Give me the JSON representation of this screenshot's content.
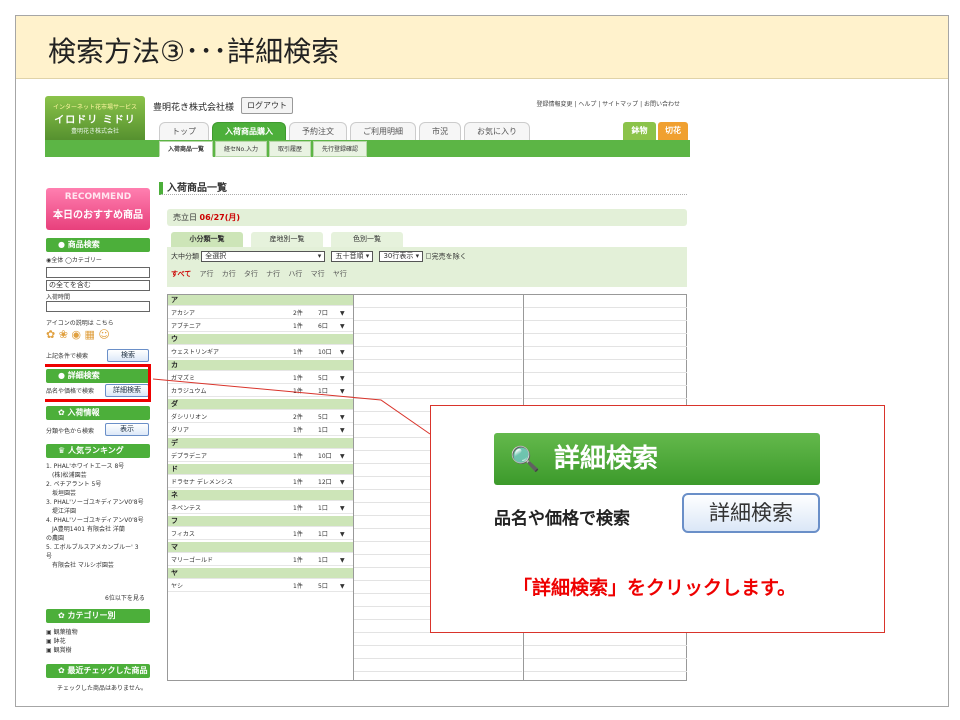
{
  "slide": {
    "title": "検索方法③･･･詳細検索"
  },
  "header": {
    "logo": {
      "line1": "インターネット花市場サービス",
      "line2": "イロドリ ミドリ",
      "line3": "豊明花き株式会社"
    },
    "company": "豊明花き株式会社様",
    "logout": "ログアウト",
    "toplinks": "登録情報変更 | ヘルプ | サイトマップ | お問い合わせ"
  },
  "tabs": [
    "トップ",
    "入荷商品購入",
    "予約注文",
    "ご利用明細",
    "市況",
    "お気に入り"
  ],
  "active_tab": "入荷商品購入",
  "right_tabs": {
    "a": "鉢物",
    "b": "切花"
  },
  "subtabs": [
    "入荷商品一覧",
    "経セNo.入力",
    "取引履歴",
    "先行登録確認"
  ],
  "sidebar": {
    "recommend_top": "RECOMMEND",
    "recommend_bottom": "本日のおすすめ商品",
    "search_head": "商品検索",
    "radio": "◉全体 ◯カテゴリー",
    "select1": "の全てを含む",
    "arrival_label": "入荷時間",
    "icon_note": "アイコンの説明は こちら",
    "condition_label": "上記条件で検索",
    "search_btn": "検索",
    "detail_head": "詳細検索",
    "detail_label": "品名や価格で検索",
    "detail_btn": "詳細検索",
    "arrival_head": "入荷情報",
    "arrival_text": "分類や色から検索",
    "show_btn": "表示",
    "ranking_head": "人気ランキング",
    "ranking": [
      "1. PHAL'ホワイトエース 8号",
      "　(株)松浦園芸",
      "2. ペチアラント 5号",
      "　坂垣園芸",
      "3. PHAL'ソーゴユキディアンV0'8号",
      "　堤江洋園",
      "4. PHAL'ソーゴユキディアンV0'8号",
      "　JA豊明1401 有限会社 洋蘭",
      "の農園",
      "5. エボルブルスアメカンブルー' 3",
      "号",
      "　有限会社 マルシポ園芸"
    ],
    "more": "6位以下を見る",
    "category_head": "カテゴリー別",
    "categories": [
      "観葉植物",
      "鉢花",
      "観賞樹"
    ],
    "recent_head": "最近チェックした商品",
    "recent_text": "チェックした商品はありません。"
  },
  "main": {
    "heading": "入荷商品一覧",
    "date_label": "売立日",
    "date_value": "06/27(月)",
    "content_tabs": [
      "小分類一覧",
      "産地別一覧",
      "色別一覧"
    ],
    "filter_label": "大中分類",
    "filter_select": "全選択",
    "sort_select": "五十音順",
    "rows_select": "30行表示",
    "exclude_label": "完売を除く",
    "kana_all": "すべて",
    "kana": "ア行 カ行 タ行 ナ行 ハ行 マ行 ヤ行"
  },
  "list": [
    {
      "head": "ア"
    },
    {
      "name": "アカシア",
      "count": "2件",
      "qty": "7口"
    },
    {
      "name": "アブチニア",
      "count": "1件",
      "qty": "6口"
    },
    {
      "head": "ウ"
    },
    {
      "name": "ウェストリンギア",
      "count": "1件",
      "qty": "10口"
    },
    {
      "head": "カ"
    },
    {
      "name": "ガマズミ",
      "count": "1件",
      "qty": "5口"
    },
    {
      "name": "カラジュウム",
      "count": "1件",
      "qty": "1口"
    },
    {
      "head": "ダ"
    },
    {
      "name": "ダシリリオン",
      "count": "2件",
      "qty": "5口"
    },
    {
      "name": "ダリア",
      "count": "1件",
      "qty": "1口"
    },
    {
      "head": "デ"
    },
    {
      "name": "デプラデニア",
      "count": "1件",
      "qty": "10口"
    },
    {
      "head": "ド"
    },
    {
      "name": "ドラセナ デレメンシス",
      "count": "1件",
      "qty": "12口"
    },
    {
      "head": "ネ"
    },
    {
      "name": "ネペンテス",
      "count": "1件",
      "qty": "1口"
    },
    {
      "head": "フ"
    },
    {
      "name": "フィカス",
      "count": "1件",
      "qty": "1口"
    },
    {
      "head": "マ"
    },
    {
      "name": "マリーゴールド",
      "count": "1件",
      "qty": "1口"
    },
    {
      "head": "ヤ"
    },
    {
      "name": "ヤシ",
      "count": "1件",
      "qty": "5口"
    }
  ],
  "callout": {
    "bar": "詳細検索",
    "label": "品名や価格で検索",
    "button": "詳細検索",
    "message": "「詳細検索」をクリックします。"
  }
}
